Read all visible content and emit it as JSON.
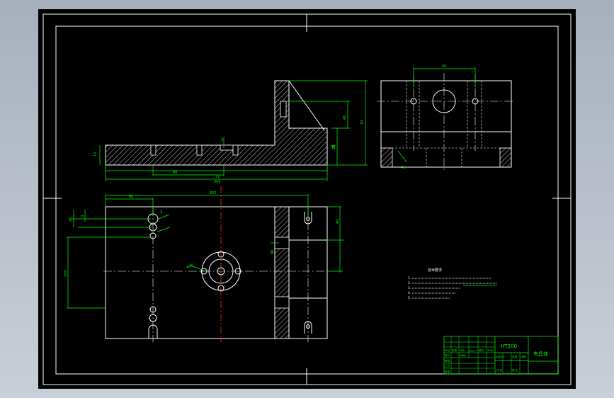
{
  "title_block": {
    "material": "HT200",
    "part_name": "夹具体",
    "cells": [
      "标记",
      "处数",
      "分区",
      "更改文件号",
      "签名",
      "年月日",
      "设计",
      "标准化",
      "审核",
      "工艺",
      "批准",
      "阶段标记",
      "重量",
      "比例",
      "共 张",
      "第 张"
    ]
  },
  "tech_req": {
    "heading": "技术要求",
    "items": [
      "1.",
      "2.",
      "3.",
      "4.",
      "5."
    ]
  },
  "dims": {
    "front": [
      "15",
      "72",
      "80",
      "300",
      "70",
      "40",
      "50",
      "50",
      "2"
    ],
    "side": [
      "45",
      "45"
    ],
    "plan": [
      "302",
      "60",
      "35",
      "3",
      "3",
      "150",
      "40",
      "40",
      "Φ80"
    ]
  },
  "colors": {
    "outline": "#ffffff",
    "dimension": "#00ff00",
    "centerline": "#ff2a2a",
    "background": "#000000"
  }
}
